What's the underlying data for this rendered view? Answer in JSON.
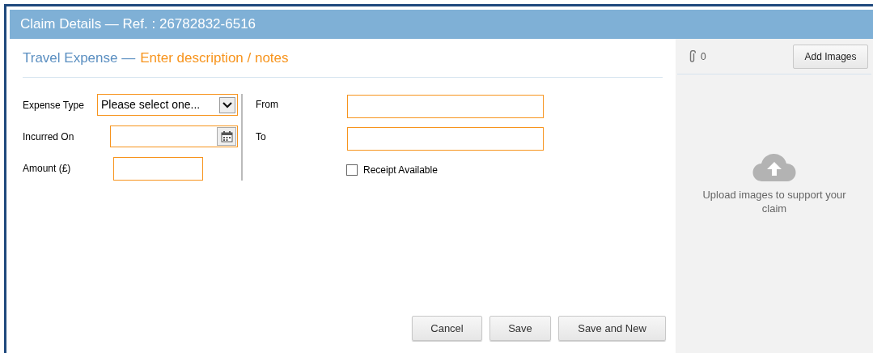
{
  "header": {
    "title": "Claim Details — Ref. : 26782832-6516"
  },
  "heading": {
    "category": "Travel Expense —",
    "description_placeholder": "Enter description / notes"
  },
  "left_fields": [
    {
      "label": "Expense Type",
      "kind": "select",
      "value": "Please select one..."
    },
    {
      "label": "Incurred On",
      "kind": "date"
    },
    {
      "label": "Amount (£)",
      "kind": "amount"
    }
  ],
  "right_fields": [
    {
      "label": "From"
    },
    {
      "label": "To"
    }
  ],
  "receipt": {
    "label": "Receipt Available",
    "checked": false
  },
  "buttons": [
    "Cancel",
    "Save",
    "Save and New"
  ],
  "attachments": {
    "count": "0",
    "add_button": "Add Images",
    "upload_text": "Upload images to support your claim"
  }
}
